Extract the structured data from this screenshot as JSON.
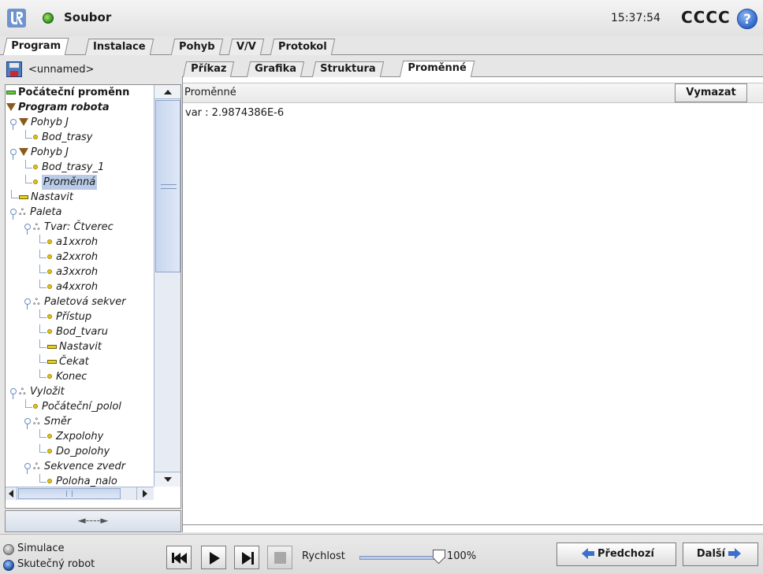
{
  "header": {
    "app_title": "Soubor",
    "time": "15:37:54",
    "robot_name": "CCCC",
    "help_symbol": "?",
    "logo_icon": "universal-robots-logo",
    "status_color": "#2d8a1e"
  },
  "main_tabs": [
    {
      "label": "Program",
      "active": true
    },
    {
      "label": "Instalace",
      "active": false
    },
    {
      "label": "Pohyb",
      "active": false
    },
    {
      "label": "V/V",
      "active": false
    },
    {
      "label": "Protokol",
      "active": false
    }
  ],
  "program": {
    "file_name": "<unnamed>",
    "tree": [
      {
        "label": "Počáteční proměnn",
        "icon": "bar-green",
        "style": "bold"
      },
      {
        "label": "Program robota",
        "icon": "triangle",
        "style": "bold-italic"
      },
      {
        "label": "Pohyb J",
        "icon": "triangle",
        "style": "italic"
      },
      {
        "label": "Bod_trasy",
        "icon": "dot",
        "style": "italic"
      },
      {
        "label": "Pohyb J",
        "icon": "triangle",
        "style": "italic"
      },
      {
        "label": "Bod_trasy_1",
        "icon": "dot",
        "style": "italic"
      },
      {
        "label": "Proměnná",
        "icon": "dot",
        "style": "italic",
        "selected": true
      },
      {
        "label": "Nastavit",
        "icon": "bar",
        "style": "italic"
      },
      {
        "label": "Paleta",
        "icon": "pallet",
        "style": "italic"
      },
      {
        "label": "Tvar: Čtverec",
        "icon": "pallet",
        "style": "italic"
      },
      {
        "label": "a1xxroh",
        "icon": "dot",
        "style": "italic"
      },
      {
        "label": "a2xxroh",
        "icon": "dot",
        "style": "italic"
      },
      {
        "label": "a3xxroh",
        "icon": "dot",
        "style": "italic"
      },
      {
        "label": "a4xxroh",
        "icon": "dot",
        "style": "italic"
      },
      {
        "label": "Paletová sekver",
        "icon": "pallet",
        "style": "italic"
      },
      {
        "label": "Přístup",
        "icon": "dot",
        "style": "italic"
      },
      {
        "label": "Bod_tvaru",
        "icon": "dot",
        "style": "italic"
      },
      {
        "label": "Nastavit",
        "icon": "bar",
        "style": "italic"
      },
      {
        "label": "Čekat",
        "icon": "bar",
        "style": "italic"
      },
      {
        "label": "Konec",
        "icon": "dot",
        "style": "italic"
      },
      {
        "label": "Vyložit",
        "icon": "pallet",
        "style": "italic"
      },
      {
        "label": "Počáteční_polol",
        "icon": "dot",
        "style": "italic"
      },
      {
        "label": "Směr",
        "icon": "pallet",
        "style": "italic"
      },
      {
        "label": "Zxpolohy",
        "icon": "dot",
        "style": "italic"
      },
      {
        "label": "Do_polohy",
        "icon": "dot",
        "style": "italic"
      },
      {
        "label": "Sekvence zvedr",
        "icon": "pallet",
        "style": "italic"
      },
      {
        "label": "Poloha_nalo",
        "icon": "dot",
        "style": "italic"
      }
    ],
    "resize_symbol": "◄----►"
  },
  "sub_tabs": [
    {
      "label": "Příkaz",
      "active": false
    },
    {
      "label": "Grafika",
      "active": false
    },
    {
      "label": "Struktura",
      "active": false
    },
    {
      "label": "Proměnné",
      "active": true
    }
  ],
  "variables_view": {
    "title": "Proměnné",
    "clear_label": "Vymazat",
    "lines": [
      "var : 2.9874386E-6"
    ]
  },
  "footer": {
    "mode_simulation": "Simulace",
    "mode_real": "Skutečný robot",
    "speed_label": "Rychlost",
    "speed_value_text": "100%",
    "speed_fraction": 1.0,
    "prev_label": "Předchozí",
    "next_label": "Další",
    "accent_color": "#3a6fcc"
  }
}
